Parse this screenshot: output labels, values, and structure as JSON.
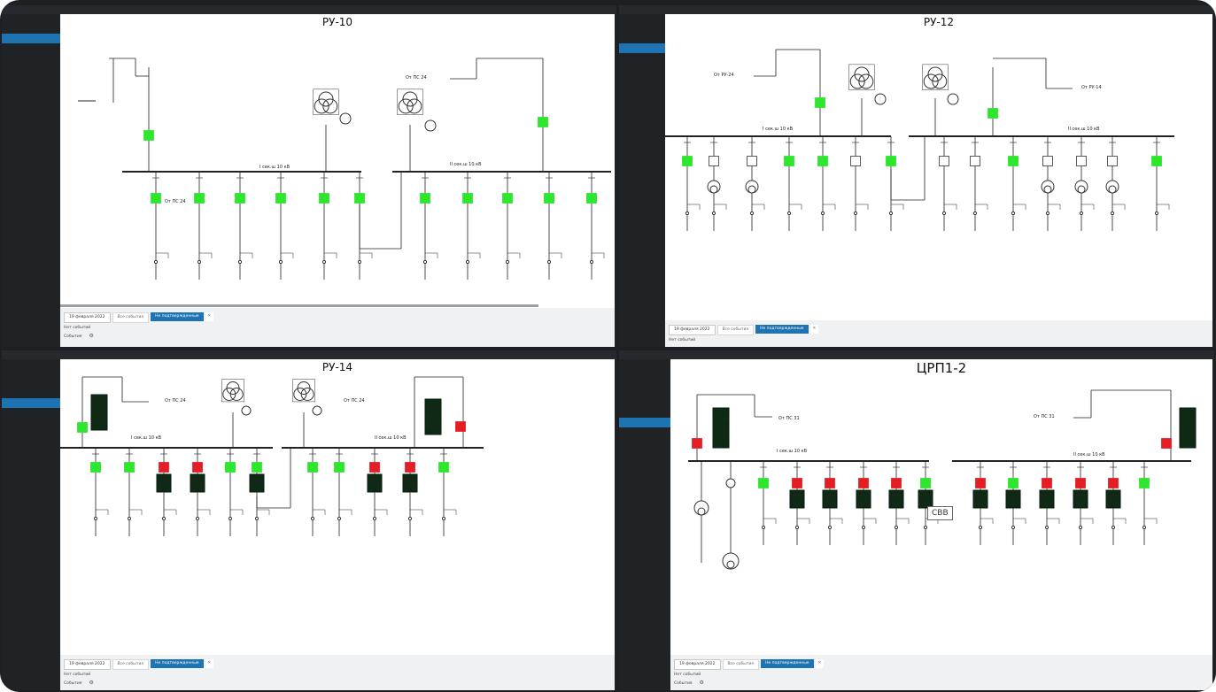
{
  "colors": {
    "on": "#2ee62e",
    "off": "#e31e24",
    "dark": "#0e2a14",
    "bus": "#222222",
    "sidebar_active": "#1e73b3"
  },
  "sidebar": {
    "items": [
      "",
      "",
      "",
      "",
      "",
      "",
      "",
      "",
      "",
      ""
    ]
  },
  "panels": [
    {
      "id": "p1",
      "title": "РУ-10",
      "sections": [
        "I сек.ш 10 кВ",
        "II сек.ш 10 кВ"
      ],
      "feed_left": "От ПС 24",
      "feed_right": "От ПС 24",
      "bottom": {
        "date": "19 февраля 2022",
        "tab1": "Все события",
        "tab2": "Не подтвержденные",
        "x": "✕",
        "line1": "Нет событий",
        "line2": "События"
      }
    },
    {
      "id": "p2",
      "title": "РУ-12",
      "sections": [
        "I сек.ш 10 кВ",
        "II сек.ш 10 кВ"
      ],
      "feed_left": "От РУ-24",
      "feed_right": "От РУ-14",
      "bottom": {
        "date": "19 февраля 2022",
        "tab1": "Все события",
        "tab2": "Не подтвержденные",
        "x": "✕",
        "line1": "Нет событий",
        "line2": ""
      }
    },
    {
      "id": "p3",
      "title": "РУ-14",
      "sections": [
        "I сек.ш 10 кВ",
        "II сек.ш 10 кВ"
      ],
      "feed_left": "От ПС 24",
      "feed_right": "От ПС 24",
      "bottom": {
        "date": "19 февраля 2022",
        "tab1": "Все события",
        "tab2": "Не подтвержденные",
        "x": "✕",
        "line1": "Нет событий",
        "line2": "События"
      }
    },
    {
      "id": "p4",
      "title": "ЦРП1-2",
      "sections": [
        "I сек.ш 10 кВ",
        "II сек.ш 10 кВ"
      ],
      "feed_left": "От ПС 31",
      "feed_right": "От ПС 31",
      "svb": "СВВ",
      "bottom": {
        "date": "19 февраля 2022",
        "tab1": "Все события",
        "tab2": "Не подтвержденные",
        "x": "✕",
        "line1": "Нет событий",
        "line2": "События"
      }
    }
  ]
}
